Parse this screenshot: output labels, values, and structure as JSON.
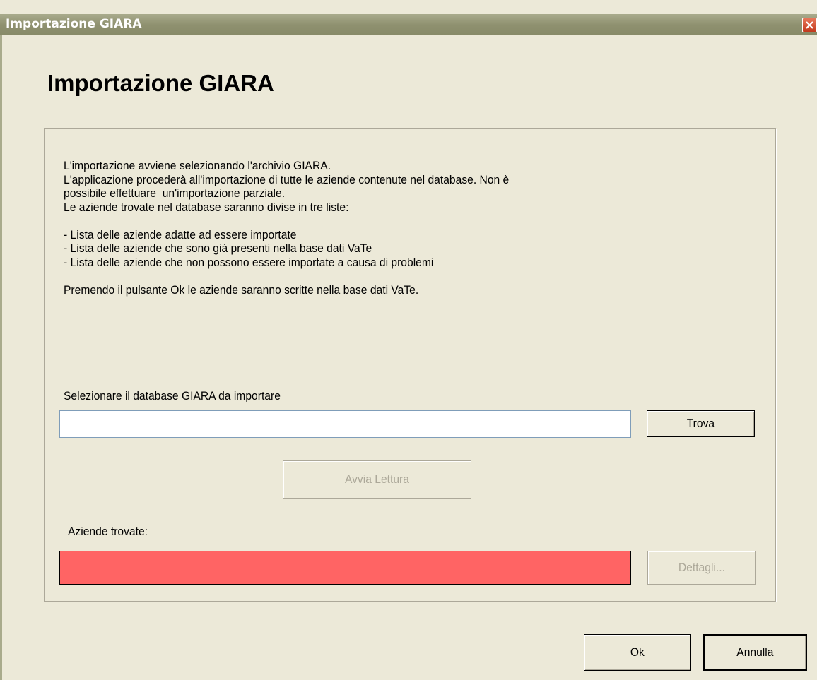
{
  "window": {
    "title": "Importazione GIARA"
  },
  "header": {
    "heading": "Importazione GIARA"
  },
  "description": {
    "text": "L'importazione avviene selezionando l'archivio GIARA.\nL'applicazione procederà all'importazione di tutte le aziende contenute nel database. Non è\npossibile effettuare  un'importazione parziale.\nLe aziende trovate nel database saranno divise in tre liste:\n\n- Lista delle aziende adatte ad essere importate\n- Lista delle aziende che sono già presenti nella base dati VaTe\n- Lista delle aziende che non possono essere importate a causa di problemi\n\nPremendo il pulsante Ok le aziende saranno scritte nella base dati VaTe."
  },
  "database": {
    "label": "Selezionare il database GIARA da importare",
    "value": "",
    "browse_label": "Trova"
  },
  "read": {
    "button_label": "Avvia Lettura"
  },
  "results": {
    "label": "Aziende trovate:",
    "value": "",
    "details_label": "Dettagli...",
    "status_color": "#ff6464"
  },
  "footer": {
    "ok_label": "Ok",
    "cancel_label": "Annulla"
  },
  "icons": {
    "close": "close-icon"
  }
}
